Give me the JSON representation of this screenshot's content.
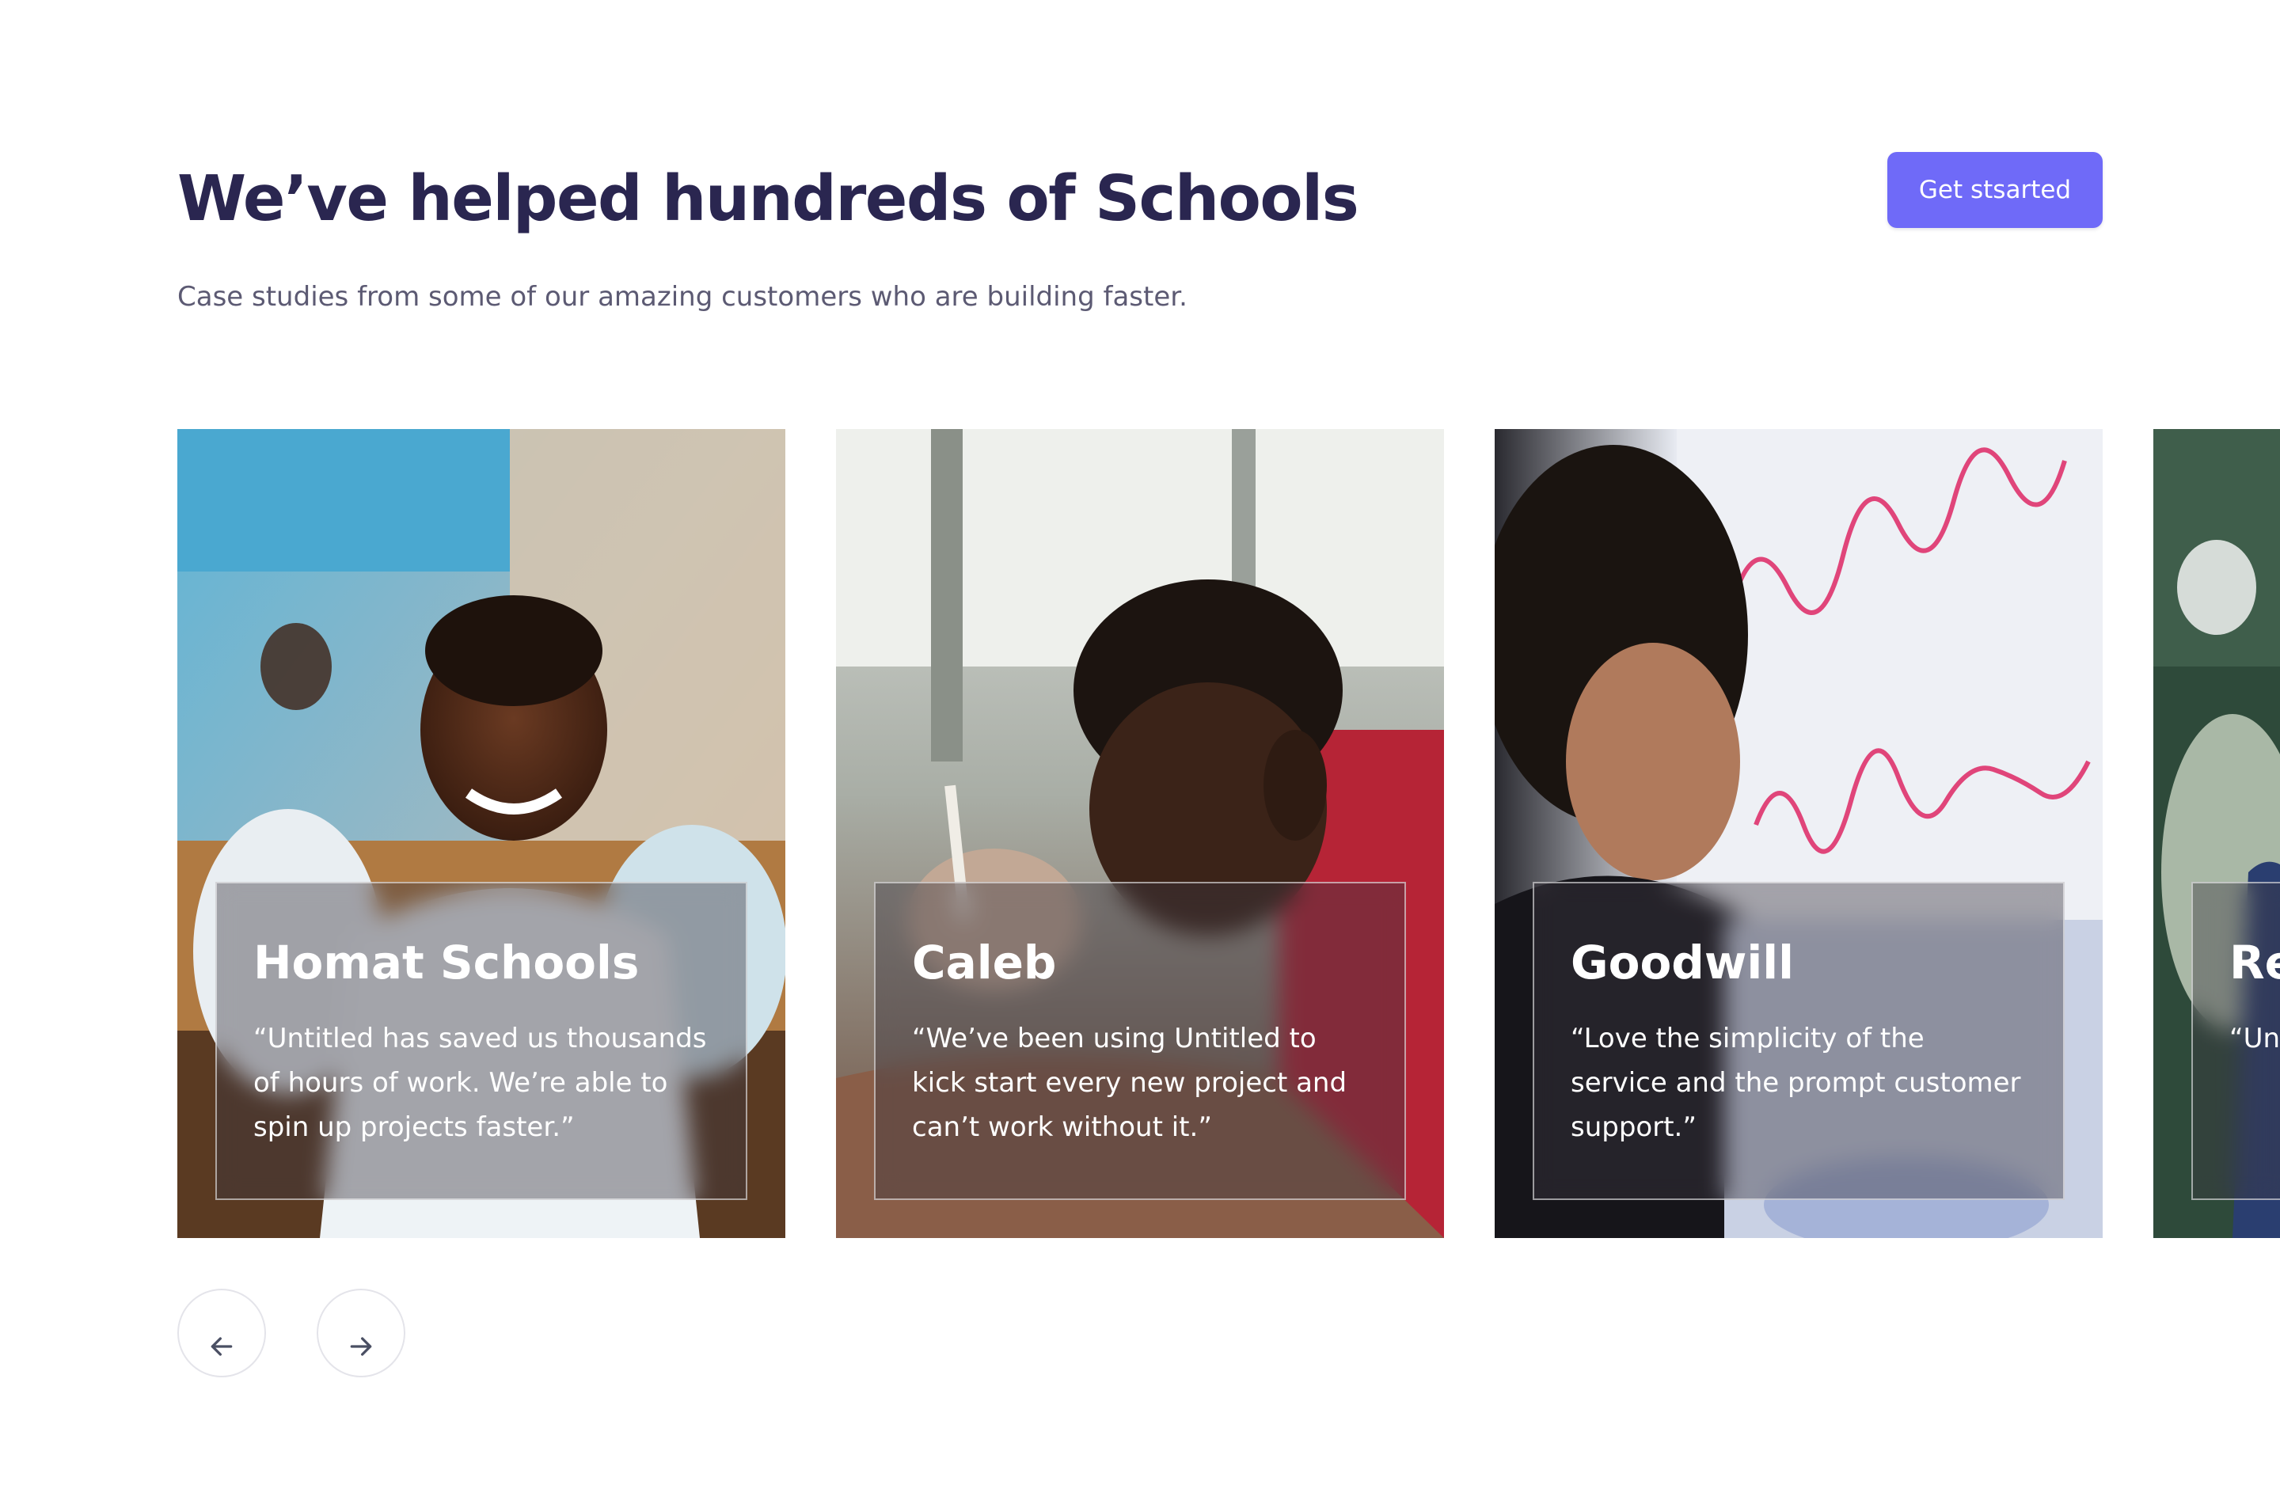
{
  "header": {
    "title": "We’ve helped hundreds of Schools",
    "subtitle": "Case studies from some of our amazing customers who are building faster.",
    "cta_label": "Get stsarted"
  },
  "colors": {
    "title": "#2a2650",
    "subtitle": "#5c5a73",
    "accent": "#6f6af8"
  },
  "cards": [
    {
      "name": "Homat Schools",
      "quote": "“Untitled has saved us thousands of hours of work. We’re able to spin up projects faster.”",
      "image_icon": "student-smiling-photo"
    },
    {
      "name": "Caleb",
      "quote": "“We’ve been using Untitled to kick start every new project and can’t work without it.”",
      "image_icon": "student-writing-photo"
    },
    {
      "name": "Goodwill",
      "quote": "“Love the simplicity of the service and the prompt customer support.”",
      "image_icon": "teacher-whiteboard-photo"
    },
    {
      "name": "Re",
      "quote": "“Un of h spin",
      "image_icon": "classroom-photo"
    }
  ],
  "carousel": {
    "prev_icon": "arrow-left-icon",
    "next_icon": "arrow-right-icon"
  }
}
